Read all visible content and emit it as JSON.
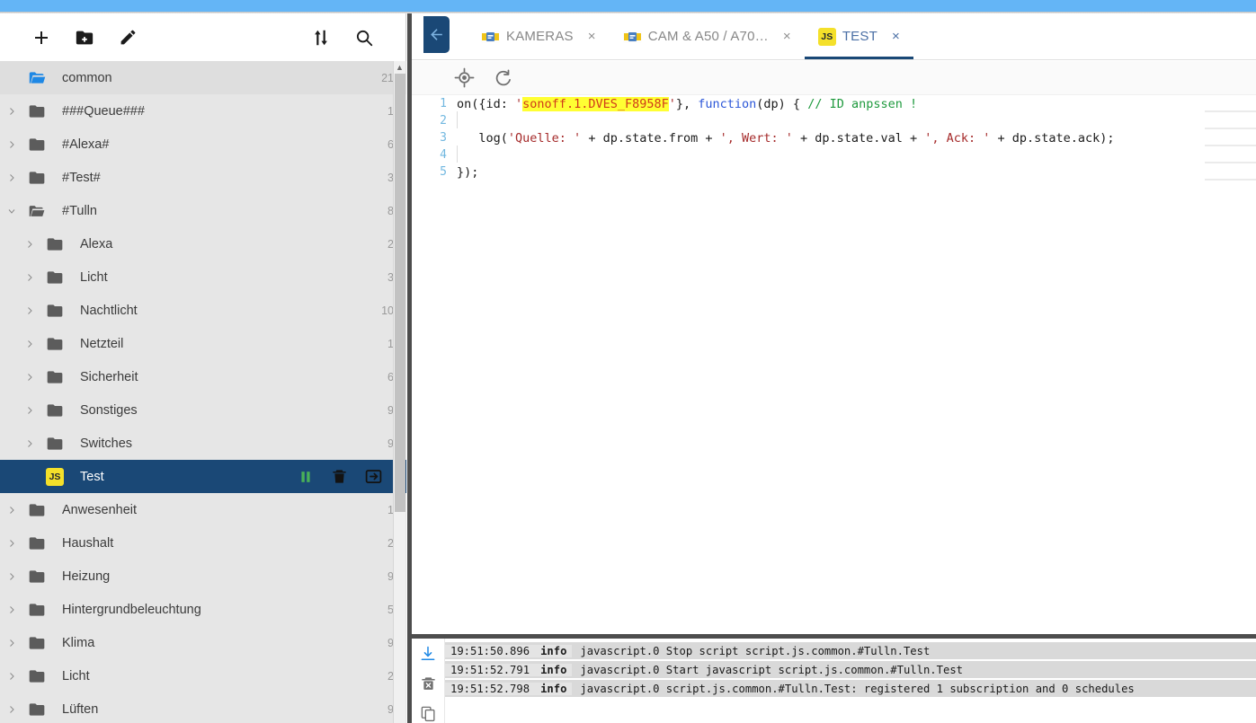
{
  "theme": {
    "accent_blue": "#64b5f6",
    "selected_navy": "#1a4876",
    "js_yellow": "#f4e02a",
    "tree_bg": "#e6e6e6",
    "running_green": "#4caf50"
  },
  "sidebar": {
    "toolbar": [
      {
        "name": "add-script-button",
        "icon": "plus-icon",
        "label": "+"
      },
      {
        "name": "add-folder-button",
        "icon": "folder-plus-icon",
        "label": ""
      },
      {
        "name": "rename-button",
        "icon": "pencil-icon",
        "label": ""
      },
      {
        "name": "expand-collapse-button",
        "icon": "sort-arrows-icon",
        "label": ""
      },
      {
        "name": "search-button",
        "icon": "search-icon",
        "label": ""
      }
    ],
    "root": {
      "label": "common",
      "count": "21",
      "icon": "folder-open-icon"
    },
    "items": [
      {
        "label": "###Queue###",
        "count": "1",
        "depth": 0,
        "type": "folder",
        "expanded": false
      },
      {
        "label": "#Alexa#",
        "count": "6",
        "depth": 0,
        "type": "folder",
        "expanded": false
      },
      {
        "label": "#Test#",
        "count": "3",
        "depth": 0,
        "type": "folder",
        "expanded": false
      },
      {
        "label": "#Tulln",
        "count": "8",
        "depth": 0,
        "type": "folder",
        "expanded": true
      },
      {
        "label": "Alexa",
        "count": "2",
        "depth": 1,
        "type": "folder",
        "expanded": false
      },
      {
        "label": "Licht",
        "count": "3",
        "depth": 1,
        "type": "folder",
        "expanded": false
      },
      {
        "label": "Nachtlicht",
        "count": "10",
        "depth": 1,
        "type": "folder",
        "expanded": false
      },
      {
        "label": "Netzteil",
        "count": "1",
        "depth": 1,
        "type": "folder",
        "expanded": false
      },
      {
        "label": "Sicherheit",
        "count": "6",
        "depth": 1,
        "type": "folder",
        "expanded": false
      },
      {
        "label": "Sonstiges",
        "count": "9",
        "depth": 1,
        "type": "folder",
        "expanded": false
      },
      {
        "label": "Switches",
        "count": "9",
        "depth": 1,
        "type": "folder",
        "expanded": false
      },
      {
        "label": "Test",
        "count": "",
        "depth": 1,
        "type": "script",
        "selected": true,
        "badge": "JS",
        "actions": [
          {
            "name": "pause-script-button",
            "icon": "pause-icon"
          },
          {
            "name": "delete-script-button",
            "icon": "trash-icon"
          },
          {
            "name": "export-script-button",
            "icon": "export-icon"
          }
        ]
      },
      {
        "label": "Anwesenheit",
        "count": "1",
        "depth": 0,
        "type": "folder",
        "expanded": false
      },
      {
        "label": "Haushalt",
        "count": "2",
        "depth": 0,
        "type": "folder",
        "expanded": false
      },
      {
        "label": "Heizung",
        "count": "9",
        "depth": 0,
        "type": "folder",
        "expanded": false
      },
      {
        "label": "Hintergrundbeleuchtung",
        "count": "5",
        "depth": 0,
        "type": "folder",
        "expanded": false
      },
      {
        "label": "Klima",
        "count": "9",
        "depth": 0,
        "type": "folder",
        "expanded": false
      },
      {
        "label": "Licht",
        "count": "2",
        "depth": 0,
        "type": "folder",
        "expanded": false
      },
      {
        "label": "Lüften",
        "count": "9",
        "depth": 0,
        "type": "folder",
        "expanded": false
      }
    ]
  },
  "tabbar": {
    "back_button": "back-arrow-icon",
    "tabs": [
      {
        "label": "KAMERAS",
        "icon": "blockly-icon",
        "active": false,
        "close": "×"
      },
      {
        "label": "CAM & A50 / A70…",
        "icon": "blockly-icon",
        "active": false,
        "close": "×"
      },
      {
        "label": "TEST",
        "icon": "js-icon",
        "badge": "JS",
        "active": true,
        "close": "×"
      }
    ]
  },
  "editor": {
    "toolbar": [
      {
        "name": "locate-icon",
        "title": ""
      },
      {
        "name": "reload-icon",
        "title": ""
      }
    ],
    "lines": [
      {
        "no": "1",
        "tokens": [
          {
            "t": "plain",
            "v": "on({id: "
          },
          {
            "t": "str",
            "v": "'"
          },
          {
            "t": "str-hl",
            "v": "sonoff.1.DVES_F8958F"
          },
          {
            "t": "str",
            "v": "'"
          },
          {
            "t": "plain",
            "v": "}, "
          },
          {
            "t": "kw",
            "v": "function"
          },
          {
            "t": "plain",
            "v": "(dp) { "
          },
          {
            "t": "com",
            "v": "// ID anpssen !"
          }
        ]
      },
      {
        "no": "2",
        "tokens": []
      },
      {
        "no": "3",
        "tokens": [
          {
            "t": "plain",
            "v": "   log("
          },
          {
            "t": "str",
            "v": "'Quelle: '"
          },
          {
            "t": "plain",
            "v": " + dp.state.from + "
          },
          {
            "t": "str",
            "v": "', Wert: '"
          },
          {
            "t": "plain",
            "v": " + dp.state.val + "
          },
          {
            "t": "str",
            "v": "', Ack: '"
          },
          {
            "t": "plain",
            "v": " + dp.state.ack);"
          }
        ]
      },
      {
        "no": "4",
        "tokens": []
      },
      {
        "no": "5",
        "tokens": [
          {
            "t": "plain",
            "v": "});"
          }
        ]
      }
    ]
  },
  "log": {
    "tools": [
      {
        "name": "download-log-icon"
      },
      {
        "name": "clear-log-icon"
      },
      {
        "name": "copy-log-icon"
      }
    ],
    "entries": [
      {
        "time": "19:51:50.896",
        "severity": "info",
        "message": "javascript.0 Stop script script.js.common.#Tulln.Test"
      },
      {
        "time": "19:51:52.791",
        "severity": "info",
        "message": "javascript.0 Start javascript script.js.common.#Tulln.Test"
      },
      {
        "time": "19:51:52.798",
        "severity": "info",
        "message": "javascript.0 script.js.common.#Tulln.Test: registered 1 subscription and 0 schedules"
      }
    ]
  }
}
